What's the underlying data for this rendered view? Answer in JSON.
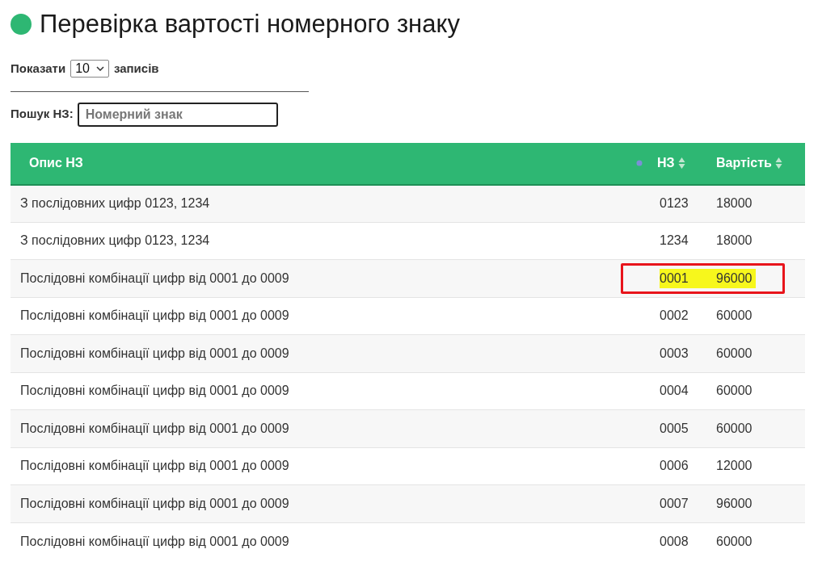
{
  "title": "Перевірка вартості номерного знаку",
  "length_menu": {
    "before": "Показати",
    "value": "10",
    "after": "записів"
  },
  "search": {
    "label": "Пошук НЗ:",
    "placeholder": "Номерний знак"
  },
  "table": {
    "columns": [
      {
        "label": "Опис НЗ",
        "sorted": true
      },
      {
        "label": "НЗ",
        "sorted": false
      },
      {
        "label": "Вартість",
        "sorted": false
      }
    ],
    "rows": [
      {
        "description": "З послідовних цифр 0123, 1234",
        "plate": "0123",
        "price": "18000",
        "highlighted": false
      },
      {
        "description": "З послідовних цифр 0123, 1234",
        "plate": "1234",
        "price": "18000",
        "highlighted": false
      },
      {
        "description": "Послідовні комбінації цифр від 0001 до 0009",
        "plate": "0001",
        "price": "96000",
        "highlighted": true
      },
      {
        "description": "Послідовні комбінації цифр від 0001 до 0009",
        "plate": "0002",
        "price": "60000",
        "highlighted": false
      },
      {
        "description": "Послідовні комбінації цифр від 0001 до 0009",
        "plate": "0003",
        "price": "60000",
        "highlighted": false
      },
      {
        "description": "Послідовні комбінації цифр від 0001 до 0009",
        "plate": "0004",
        "price": "60000",
        "highlighted": false
      },
      {
        "description": "Послідовні комбінації цифр від 0001 до 0009",
        "plate": "0005",
        "price": "60000",
        "highlighted": false
      },
      {
        "description": "Послідовні комбінації цифр від 0001 до 0009",
        "plate": "0006",
        "price": "12000",
        "highlighted": false
      },
      {
        "description": "Послідовні комбінації цифр від 0001 до 0009",
        "plate": "0007",
        "price": "96000",
        "highlighted": false
      },
      {
        "description": "Послідовні комбінації цифр від 0001 до 0009",
        "plate": "0008",
        "price": "60000",
        "highlighted": false
      }
    ]
  }
}
